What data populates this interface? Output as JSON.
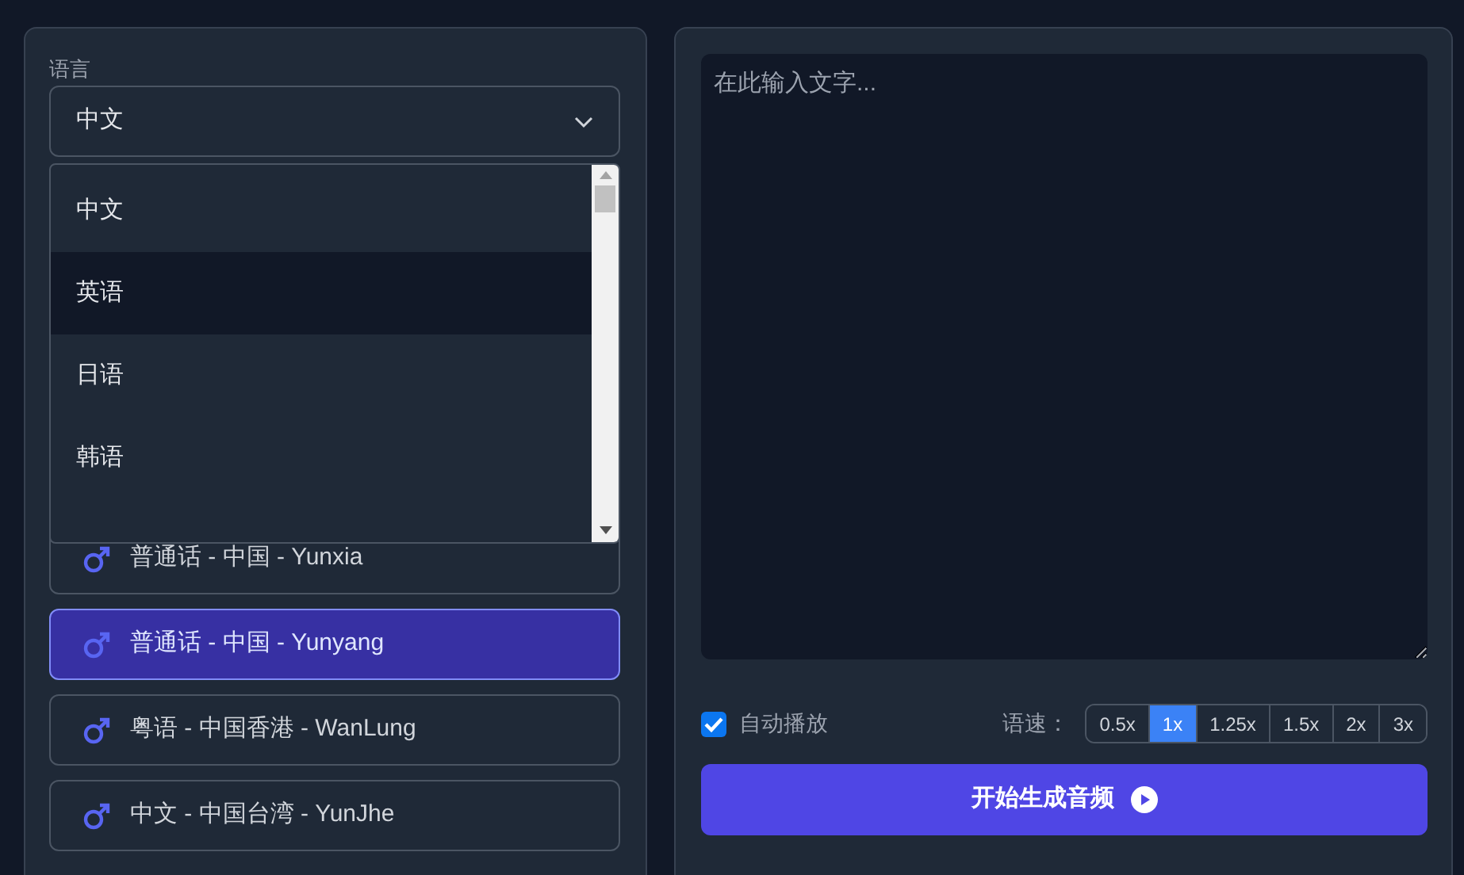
{
  "language": {
    "label": "语言",
    "value": "中文",
    "expanded": true,
    "options": [
      {
        "label": "中文",
        "highlighted": false
      },
      {
        "label": "英语",
        "highlighted": true
      },
      {
        "label": "日语",
        "highlighted": false
      },
      {
        "label": "韩语",
        "highlighted": false
      }
    ]
  },
  "voices": [
    {
      "label": "普通话 - 中国 - Yunxia",
      "selected": false
    },
    {
      "label": "普通话 - 中国 - Yunyang",
      "selected": true
    },
    {
      "label": "粤语 - 中国香港 - WanLung",
      "selected": false
    },
    {
      "label": "中文 - 中国台湾 - YunJhe",
      "selected": false
    }
  ],
  "text_input": {
    "placeholder": "在此输入文字..."
  },
  "autoplay": {
    "label": "自动播放",
    "checked": true
  },
  "speed": {
    "label": "语速：",
    "options": [
      {
        "label": "0.5x",
        "selected": false
      },
      {
        "label": "1x",
        "selected": true
      },
      {
        "label": "1.25x",
        "selected": false
      },
      {
        "label": "1.5x",
        "selected": false
      },
      {
        "label": "2x",
        "selected": false
      },
      {
        "label": "3x",
        "selected": false
      }
    ]
  },
  "generate_button": {
    "label": "开始生成音频"
  }
}
